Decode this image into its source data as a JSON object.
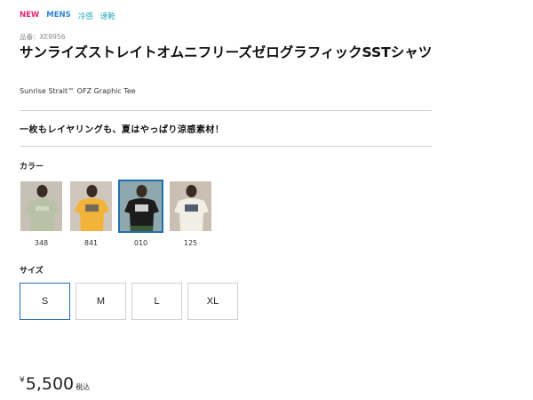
{
  "tags": [
    "NEW",
    "MENS",
    "冷感",
    "速乾"
  ],
  "product": {
    "code": "品番：XE9956",
    "title": "サンライズストレイトオムニフリーズゼログラフィックSSTシャツ",
    "title_en": "Sunrise Strait™ OFZ Graphic Tee",
    "catch": "一枚もレイヤリングも、夏はやっぱり涼感素材！"
  },
  "colors": {
    "label": "カラー",
    "options": [
      {
        "code": "348",
        "shirt": "#b9c2a6",
        "bg": "#c7c0b6",
        "selected": false
      },
      {
        "code": "841",
        "shirt": "#f2b33a",
        "bg": "#cfc6bc",
        "selected": false
      },
      {
        "code": "010",
        "shirt": "#1c1c1c",
        "bg": "#8ea8ad",
        "selected": true
      },
      {
        "code": "125",
        "shirt": "#f1eee6",
        "bg": "#c9bfb3",
        "selected": false
      }
    ]
  },
  "sizes": {
    "label": "サイズ",
    "options": [
      "S",
      "M",
      "L",
      "XL"
    ],
    "selected": "S"
  },
  "price": {
    "yen": "¥",
    "amount": "5,500",
    "tax": "税込"
  },
  "accent_color": "#1f6fb5"
}
